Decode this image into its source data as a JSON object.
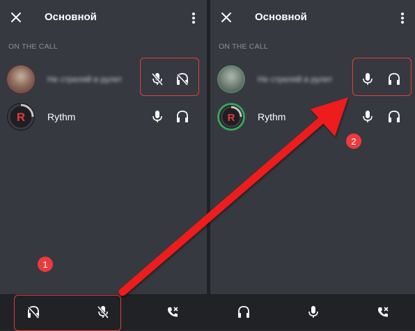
{
  "colors": {
    "accent_red": "#e0403e",
    "badge_red": "#ed3b3b",
    "panel_bg": "#36393f",
    "bar_bg": "#202225",
    "muted_text": "#8e9297"
  },
  "left": {
    "header": {
      "title": "Основной",
      "close_icon": "close-icon",
      "menu_icon": "more-vertical-icon"
    },
    "section_label": "ON THE CALL",
    "members": [
      {
        "name": "Не стреляй в рулет",
        "avatar": "user-avatar",
        "mic": "mic-off-icon",
        "headset": "headphones-off-icon"
      },
      {
        "name": "Rythm",
        "avatar": "rythm-bot-avatar",
        "mic": "mic-icon",
        "headset": "headphones-icon"
      }
    ],
    "bottom_bar": [
      "headphones-off-icon",
      "mic-off-icon",
      "end-call-icon"
    ],
    "badge": "1"
  },
  "right": {
    "header": {
      "title": "Основной",
      "close_icon": "close-icon",
      "menu_icon": "more-vertical-icon"
    },
    "section_label": "ON THE CALL",
    "members": [
      {
        "name": "Не стреляй в рулет",
        "avatar": "user-avatar",
        "mic": "mic-icon",
        "headset": "headphones-icon"
      },
      {
        "name": "Rythm",
        "avatar": "rythm-bot-avatar",
        "mic": "mic-icon",
        "headset": "headphones-icon"
      }
    ],
    "bottom_bar": [
      "headphones-icon",
      "mic-icon",
      "end-call-icon"
    ],
    "badge": "2"
  }
}
